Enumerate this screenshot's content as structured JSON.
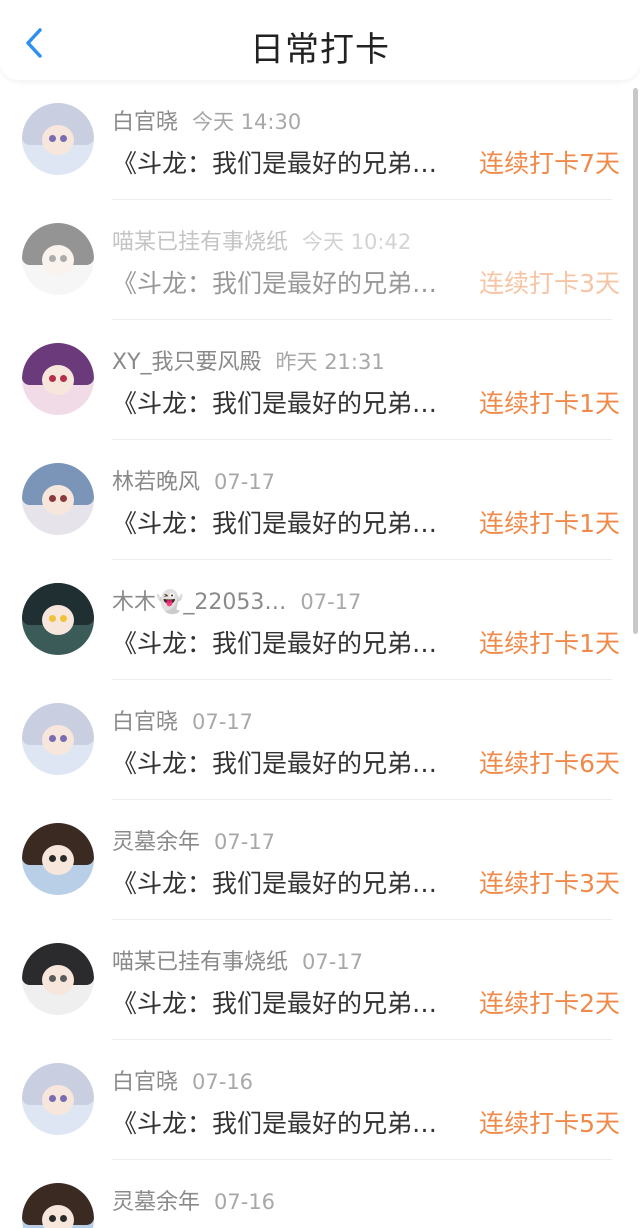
{
  "header": {
    "title": "日常打卡",
    "back_icon": "chevron-left-icon",
    "accent_color": "#2f8ff0"
  },
  "streak_color": "#f08a4b",
  "items": [
    {
      "name": "白官晓",
      "time": "今天 14:30",
      "content": "《斗龙：我们是最好的兄弟…",
      "streak": "连续打卡7天",
      "avatar": "anime-silver-hair-avatar",
      "faded": false
    },
    {
      "name": "喵某已挂有事烧纸",
      "time": "今天 10:42",
      "content": "《斗龙：我们是最好的兄弟…",
      "streak": "连续打卡3天",
      "avatar": "anime-dark-hair-avatar",
      "faded": true
    },
    {
      "name": "XY_我只要风殿",
      "time": "昨天 21:31",
      "content": "《斗龙：我们是最好的兄弟…",
      "streak": "连续打卡1天",
      "avatar": "anime-purple-hair-avatar",
      "faded": false
    },
    {
      "name": "林若晚风",
      "time": "07-17",
      "content": "《斗龙：我们是最好的兄弟…",
      "streak": "连续打卡1天",
      "avatar": "anime-blue-hair-avatar",
      "faded": false
    },
    {
      "name": "木木👻_22053…",
      "time": "07-17",
      "content": "《斗龙：我们是最好的兄弟…",
      "streak": "连续打卡1天",
      "avatar": "anime-dark-green-hair-avatar",
      "faded": false
    },
    {
      "name": "白官晓",
      "time": "07-17",
      "content": "《斗龙：我们是最好的兄弟…",
      "streak": "连续打卡6天",
      "avatar": "anime-silver-hair-avatar",
      "faded": false
    },
    {
      "name": "灵墓余年",
      "time": "07-17",
      "content": "《斗龙：我们是最好的兄弟…",
      "streak": "连续打卡3天",
      "avatar": "anime-hat-boy-avatar",
      "faded": false
    },
    {
      "name": "喵某已挂有事烧纸",
      "time": "07-17",
      "content": "《斗龙：我们是最好的兄弟…",
      "streak": "连续打卡2天",
      "avatar": "anime-dark-hair-avatar",
      "faded": false
    },
    {
      "name": "白官晓",
      "time": "07-16",
      "content": "《斗龙：我们是最好的兄弟…",
      "streak": "连续打卡5天",
      "avatar": "anime-silver-hair-avatar",
      "faded": false
    },
    {
      "name": "灵墓余年",
      "time": "07-16",
      "content": "",
      "streak": "",
      "avatar": "anime-hat-boy-avatar",
      "faded": false
    }
  ]
}
